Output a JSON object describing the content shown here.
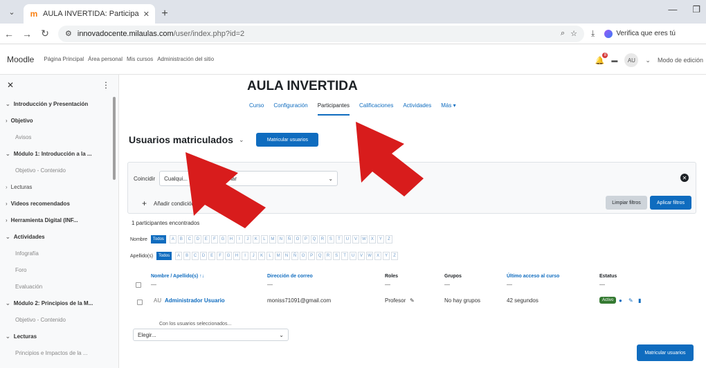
{
  "browser": {
    "tab_title": "AULA INVERTIDA: Participantes",
    "url_domain": "innovadocente.milaulas.com",
    "url_path": "/user/index.php?id=2",
    "extension_text": "Verifica que eres tú"
  },
  "moodle_nav": {
    "brand": "Moodle",
    "items": [
      "Página Principal",
      "Área personal",
      "Mis cursos",
      "Administración del sitio"
    ],
    "avatar": "AU",
    "edit_mode": "Modo de edición",
    "notification_count": "8"
  },
  "sidebar": {
    "items": [
      {
        "label": "Introducción y Presentación",
        "kind": "section",
        "prefix": "⌄"
      },
      {
        "label": "Objetivo",
        "kind": "section",
        "prefix": "›"
      },
      {
        "label": "Avisos",
        "kind": "sub",
        "prefix": ""
      },
      {
        "label": "Módulo 1: Introducción a la ...",
        "kind": "section",
        "prefix": "⌄"
      },
      {
        "label": "Objetivo - Contenido",
        "kind": "sub",
        "prefix": ""
      },
      {
        "label": "Lecturas",
        "kind": "normal",
        "prefix": "›"
      },
      {
        "label": "Videos recomendados",
        "kind": "section",
        "prefix": "›"
      },
      {
        "label": "Herramienta Digital (INF...",
        "kind": "section",
        "prefix": "›"
      },
      {
        "label": "Actividades",
        "kind": "section",
        "prefix": "⌄"
      },
      {
        "label": "Infografía",
        "kind": "sub",
        "prefix": ""
      },
      {
        "label": "Foro",
        "kind": "sub",
        "prefix": ""
      },
      {
        "label": "Evaluación",
        "kind": "sub",
        "prefix": ""
      },
      {
        "label": "Módulo 2: Principios de la M...",
        "kind": "section",
        "prefix": "⌄"
      },
      {
        "label": "Objetivo - Contenido",
        "kind": "sub",
        "prefix": ""
      },
      {
        "label": "Lecturas",
        "kind": "section",
        "prefix": "⌄"
      },
      {
        "label": "Principios e Impactos de la ...",
        "kind": "sub",
        "prefix": ""
      }
    ]
  },
  "course": {
    "title": "AULA INVERTIDA",
    "tabs": [
      "Curso",
      "Configuración",
      "Participantes",
      "Calificaciones",
      "Actividades",
      "Más ▾"
    ],
    "active_tab": "Participantes"
  },
  "participants": {
    "heading": "Usuarios matriculados",
    "enrol_button": "Matricular usuarios",
    "filter": {
      "match_label": "Coincidir",
      "match_value": "Cualqui...",
      "select_placeholder": "...eccionar",
      "add_condition": "Añadir condición",
      "clear_button": "Limpiar filtros",
      "apply_button": "Aplicar filtros"
    },
    "count_text": "1 participantes encontrados",
    "firstname_label": "Nombre",
    "lastname_label": "Apellido(s)",
    "all_label": "Todos",
    "letters": [
      "A",
      "B",
      "C",
      "D",
      "E",
      "F",
      "G",
      "H",
      "I",
      "J",
      "K",
      "L",
      "M",
      "N",
      "Ñ",
      "O",
      "P",
      "Q",
      "R",
      "S",
      "T",
      "U",
      "V",
      "W",
      "X",
      "Y",
      "Z"
    ],
    "columns": [
      "Nombre / Apellido(s) ↑↓",
      "Dirección de correo",
      "Roles",
      "Grupos",
      "Último acceso al curso",
      "Estatus"
    ],
    "rows": [
      {
        "initials": "AU",
        "name": "Administrador Usuario",
        "email": "moniss71091@gmail.com",
        "role": "Profesor",
        "groups": "No hay grupos",
        "last_access": "42 segundos",
        "status": "Activo"
      }
    ],
    "bulk_label": "Con los usuarios seleccionados...",
    "bulk_placeholder": "Elegir...",
    "bottom_button": "Matricular usuarios"
  },
  "colors": {
    "primary": "#0f6cbf",
    "annotation_arrow": "#d81c1c",
    "status_active": "#357a32"
  }
}
